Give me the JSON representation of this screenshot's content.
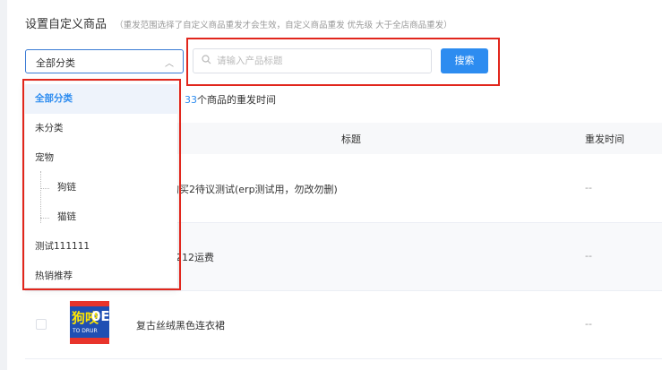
{
  "section": {
    "title": "设置自定义商品",
    "hint": "（重发范围选择了自定义商品重发才会生效，自定义商品重发 优先级 大于全店商品重发）"
  },
  "category_select": {
    "value": "全部分类",
    "chevron": "︿"
  },
  "search": {
    "placeholder": "请输入产品标题",
    "value": "",
    "button_label": "搜索",
    "icon": "search-icon"
  },
  "dropdown": {
    "items": [
      {
        "label": "全部分类",
        "active": true,
        "child": false
      },
      {
        "label": "未分类",
        "active": false,
        "child": false
      },
      {
        "label": "宠物",
        "active": false,
        "child": false
      },
      {
        "label": "狗链",
        "active": false,
        "child": true
      },
      {
        "label": "猫链",
        "active": false,
        "child": true
      },
      {
        "label": "测试111111",
        "active": false,
        "child": false
      },
      {
        "label": "热销推荐",
        "active": false,
        "child": false
      }
    ]
  },
  "count_line": {
    "number": "33",
    "text": "个商品的重发时间"
  },
  "table": {
    "headers": {
      "title": "标题",
      "time": "重发时间"
    },
    "rows": [
      {
        "title": "购买2待议测试(erp测试用，勿改勿删)",
        "time": "--"
      },
      {
        "title": "1212运费",
        "time": "--"
      },
      {
        "title": "复古丝绒黑色连衣裙",
        "time": "--"
      }
    ]
  },
  "thumbnail": {
    "text_main": "狗咬",
    "text_side": "0E",
    "text_small": "TO DRUR"
  },
  "colors": {
    "accent": "#2d8cf0",
    "annotation_red": "#e1261c"
  }
}
